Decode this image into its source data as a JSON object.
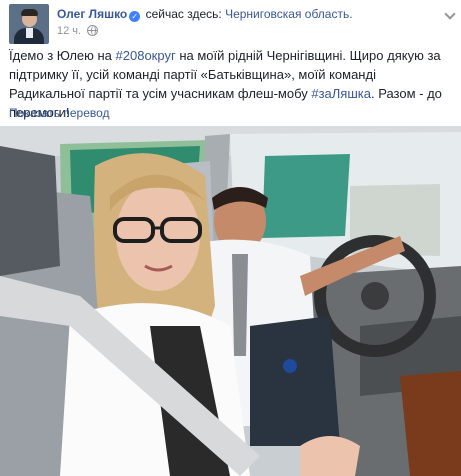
{
  "author": {
    "name": "Олег Ляшко",
    "verified_icon": "✓"
  },
  "checkin": {
    "prefix": "сейчас здесь:",
    "location": "Черниговская область."
  },
  "meta": {
    "time": "12 ч.",
    "privacy_icon": "globe-icon"
  },
  "post": {
    "seg1": "Їдемо з Юлею на ",
    "tag1": "#208округ",
    "seg2": " на моїй рідній Чернігівщині. Щиро дякую за підтримку її, усій команді партії «Батьківщина», моїй команді Радикальної партії та усім учасникам флеш-мобу ",
    "tag2": "#заЛяшка",
    "seg3": ". Разом - до перемоги!"
  },
  "translate_link": "Показать перевод",
  "colors": {
    "link": "#385898",
    "text": "#1d2129",
    "meta": "#90949c"
  }
}
